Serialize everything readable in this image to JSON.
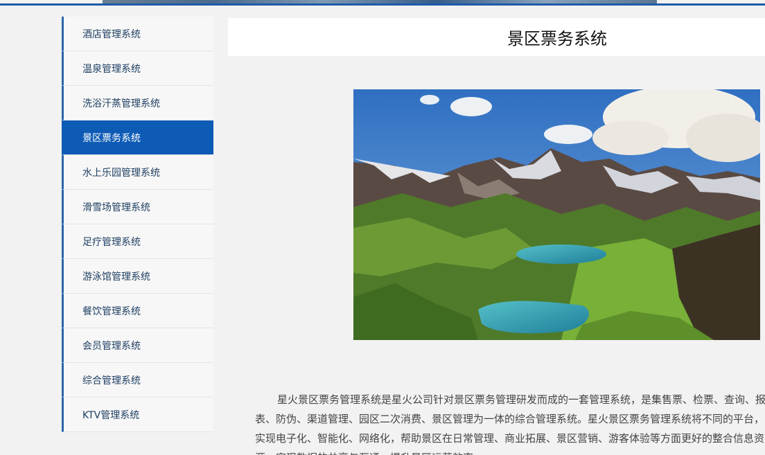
{
  "sidebar": {
    "items": [
      {
        "label": "酒店管理系统",
        "active": false
      },
      {
        "label": "温泉管理系统",
        "active": false
      },
      {
        "label": "洗浴汗蒸管理系统",
        "active": false
      },
      {
        "label": "景区票务系统",
        "active": true
      },
      {
        "label": "水上乐园管理系统",
        "active": false
      },
      {
        "label": "滑雪场管理系统",
        "active": false
      },
      {
        "label": "足疗管理系统",
        "active": false
      },
      {
        "label": "游泳馆管理系统",
        "active": false
      },
      {
        "label": "餐饮管理系统",
        "active": false
      },
      {
        "label": "会员管理系统",
        "active": false
      },
      {
        "label": "综合管理系统",
        "active": false
      },
      {
        "label": "KTV管理系统",
        "active": false
      }
    ]
  },
  "main": {
    "title": "景区票务系统",
    "article": "星火景区票务管理系统是星火公司针对景区票务管理研发而成的一套管理系统，是集售票、检票、查询、报表、防伪、渠道管理、园区二次消费、景区管理为一体的综合管理系统。星火景区票务管理系统将不同的平台，实现电子化、智能化、网络化，帮助景区在日常管理、商业拓展、景区营销、游客体验等方面更好的整合信息资源，实现数据的共享与互通，提升景区运营效率。"
  },
  "colors": {
    "accent": "#0d5bb5",
    "sidebar_border": "#2b66a8",
    "page_bg": "#f2f2f2"
  }
}
